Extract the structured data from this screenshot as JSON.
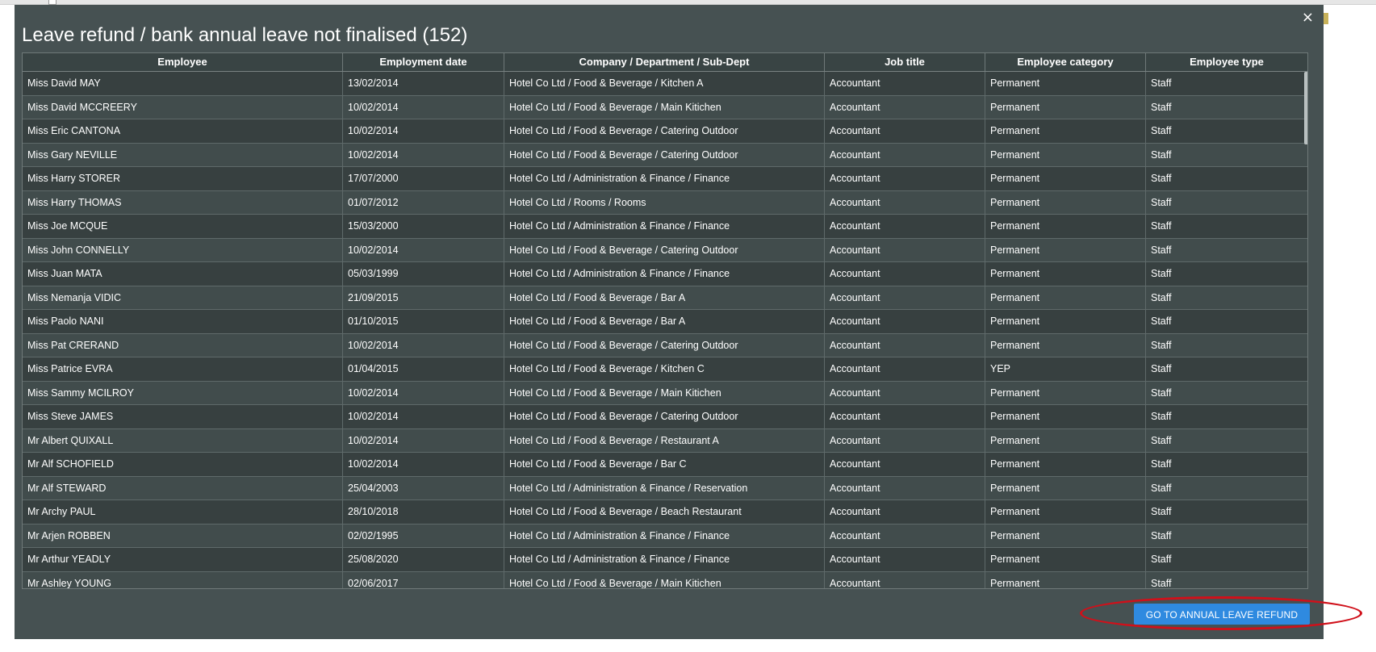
{
  "dialog": {
    "title": "Leave refund / bank annual leave not finalised (152)",
    "close_symbol": "×"
  },
  "table": {
    "columns": [
      "Employee",
      "Employment date",
      "Company / Department / Sub-Dept",
      "Job title",
      "Employee category",
      "Employee type"
    ],
    "rows": [
      [
        "Miss David MAY",
        "13/02/2014",
        "Hotel Co Ltd / Food & Beverage / Kitchen A",
        "Accountant",
        "Permanent",
        "Staff"
      ],
      [
        "Miss David MCCREERY",
        "10/02/2014",
        "Hotel Co Ltd / Food & Beverage / Main Kitichen",
        "Accountant",
        "Permanent",
        "Staff"
      ],
      [
        "Miss Eric CANTONA",
        "10/02/2014",
        "Hotel Co Ltd / Food & Beverage / Catering Outdoor",
        "Accountant",
        "Permanent",
        "Staff"
      ],
      [
        "Miss Gary NEVILLE",
        "10/02/2014",
        "Hotel Co Ltd / Food & Beverage / Catering Outdoor",
        "Accountant",
        "Permanent",
        "Staff"
      ],
      [
        "Miss Harry STORER",
        "17/07/2000",
        "Hotel Co Ltd / Administration & Finance / Finance",
        "Accountant",
        "Permanent",
        "Staff"
      ],
      [
        "Miss Harry THOMAS",
        "01/07/2012",
        "Hotel Co Ltd / Rooms / Rooms",
        "Accountant",
        "Permanent",
        "Staff"
      ],
      [
        "Miss Joe MCQUE",
        "15/03/2000",
        "Hotel Co Ltd / Administration & Finance / Finance",
        "Accountant",
        "Permanent",
        "Staff"
      ],
      [
        "Miss John CONNELLY",
        "10/02/2014",
        "Hotel Co Ltd / Food & Beverage / Catering Outdoor",
        "Accountant",
        "Permanent",
        "Staff"
      ],
      [
        "Miss Juan MATA",
        "05/03/1999",
        "Hotel Co Ltd / Administration & Finance / Finance",
        "Accountant",
        "Permanent",
        "Staff"
      ],
      [
        "Miss Nemanja VIDIC",
        "21/09/2015",
        "Hotel Co Ltd / Food & Beverage / Bar A",
        "Accountant",
        "Permanent",
        "Staff"
      ],
      [
        "Miss Paolo NANI",
        "01/10/2015",
        "Hotel Co Ltd / Food & Beverage / Bar A",
        "Accountant",
        "Permanent",
        "Staff"
      ],
      [
        "Miss Pat CRERAND",
        "10/02/2014",
        "Hotel Co Ltd / Food & Beverage / Catering Outdoor",
        "Accountant",
        "Permanent",
        "Staff"
      ],
      [
        "Miss Patrice EVRA",
        "01/04/2015",
        "Hotel Co Ltd / Food & Beverage / Kitchen C",
        "Accountant",
        "YEP",
        "Staff"
      ],
      [
        "Miss Sammy MCILROY",
        "10/02/2014",
        "Hotel Co Ltd / Food & Beverage / Main Kitichen",
        "Accountant",
        "Permanent",
        "Staff"
      ],
      [
        "Miss Steve JAMES",
        "10/02/2014",
        "Hotel Co Ltd / Food & Beverage / Catering Outdoor",
        "Accountant",
        "Permanent",
        "Staff"
      ],
      [
        "Mr Albert QUIXALL",
        "10/02/2014",
        "Hotel Co Ltd / Food & Beverage / Restaurant A",
        "Accountant",
        "Permanent",
        "Staff"
      ],
      [
        "Mr Alf SCHOFIELD",
        "10/02/2014",
        "Hotel Co Ltd / Food & Beverage / Bar C",
        "Accountant",
        "Permanent",
        "Staff"
      ],
      [
        "Mr Alf STEWARD",
        "25/04/2003",
        "Hotel Co Ltd / Administration & Finance / Reservation",
        "Accountant",
        "Permanent",
        "Staff"
      ],
      [
        "Mr Archy PAUL",
        "28/10/2018",
        "Hotel Co Ltd / Food & Beverage / Beach Restaurant",
        "Accountant",
        "Permanent",
        "Staff"
      ],
      [
        "Mr Arjen ROBBEN",
        "02/02/1995",
        "Hotel Co Ltd / Administration & Finance / Finance",
        "Accountant",
        "Permanent",
        "Staff"
      ],
      [
        "Mr Arthur YEADLY",
        "25/08/2020",
        "Hotel Co Ltd / Administration & Finance / Finance",
        "Accountant",
        "Permanent",
        "Staff"
      ],
      [
        "Mr Ashley YOUNG",
        "02/06/2017",
        "Hotel Co Ltd / Food & Beverage / Main Kitichen",
        "Accountant",
        "Permanent",
        "Staff"
      ]
    ]
  },
  "actions": {
    "go_refund_label": "GO TO ANNUAL LEAVE REFUND"
  },
  "colors": {
    "modal_bg": "#465152",
    "button_accent": "#2f8ae0",
    "annotation_ring": "#d0101a"
  }
}
